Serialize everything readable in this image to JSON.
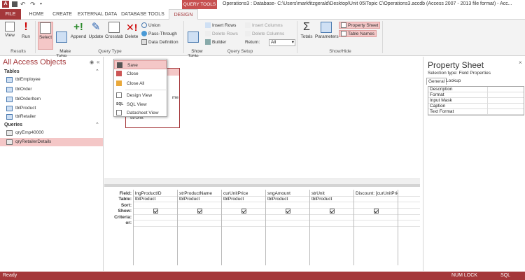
{
  "title_bar": {
    "context_tab": "QUERY TOOLS",
    "window_title": "Operations3 : Database- C:\\Users\\markfitzgerald\\Desktop\\Unit 05\\Topic C\\Operations3.accdb (Access 2007 - 2013 file format) - Acc..."
  },
  "tabs": [
    {
      "label": "FILE"
    },
    {
      "label": "HOME"
    },
    {
      "label": "CREATE"
    },
    {
      "label": "EXTERNAL DATA"
    },
    {
      "label": "DATABASE TOOLS"
    },
    {
      "label": "DESIGN"
    }
  ],
  "ribbon": {
    "results": {
      "label": "Results",
      "view": "View",
      "run": "Run"
    },
    "query_type": {
      "label": "Query Type",
      "select": "Select",
      "make_table": "Make\nTable",
      "append": "Append",
      "update": "Update",
      "crosstab": "Crosstab",
      "delete": "Delete",
      "union": "Union",
      "pass_through": "Pass-Through",
      "data_definition": "Data Definition"
    },
    "query_setup": {
      "label": "Query Setup",
      "show_table": "Show\nTable",
      "insert_rows": "Insert Rows",
      "delete_rows": "Delete Rows",
      "builder": "Builder",
      "insert_columns": "Insert Columns",
      "delete_columns": "Delete Columns",
      "return_label": "Return:",
      "return_value": "All"
    },
    "show_hide": {
      "label": "Show/Hide",
      "totals": "Totals",
      "parameters": "Parameters",
      "property_sheet": "Property Sheet",
      "table_names": "Table Names"
    }
  },
  "nav_pane": {
    "title": "All Access Objects",
    "tables_header": "Tables",
    "tables": [
      "tblEmployee",
      "tblOrder",
      "tblOrderItem",
      "tblProduct",
      "tblRetailer"
    ],
    "queries_header": "Queries",
    "queries": [
      "qryEmp40000",
      "qryRetailerDetails"
    ],
    "selected_query": "qryRetailerDetails"
  },
  "context_menu": {
    "items": [
      "Save",
      "Close",
      "Close All",
      "Design View",
      "SQL View",
      "Datasheet View"
    ]
  },
  "field_list": {
    "visible_fields": [
      "me",
      "strUnit"
    ]
  },
  "qbe_grid": {
    "row_labels": [
      "Field:",
      "Table:",
      "Sort:",
      "Show:",
      "Criteria:",
      "or:"
    ],
    "columns": [
      {
        "field": "lngProductID",
        "table": "tblProduct",
        "show": true
      },
      {
        "field": "strProductName",
        "table": "tblProduct",
        "show": true
      },
      {
        "field": "curUnitPrice",
        "table": "tblProduct",
        "show": true
      },
      {
        "field": "sngAmount",
        "table": "tblProduct",
        "show": true
      },
      {
        "field": "strUnit",
        "table": "tblProduct",
        "show": true
      },
      {
        "field": "Discount: [curUnitPric",
        "table": "",
        "show": true
      }
    ]
  },
  "property_sheet": {
    "title": "Property Sheet",
    "selection_type": "Selection type:  Field Properties",
    "tabs": [
      "General",
      "Lookup"
    ],
    "properties": [
      "Description",
      "Format",
      "Input Mask",
      "Caption",
      "Text Format"
    ]
  },
  "status_bar": {
    "left": "Ready",
    "num_lock": "NUM LOCK",
    "sql": "SQL"
  },
  "colors": {
    "accent": "#a4373a",
    "highlight": "#f4c7c7"
  }
}
